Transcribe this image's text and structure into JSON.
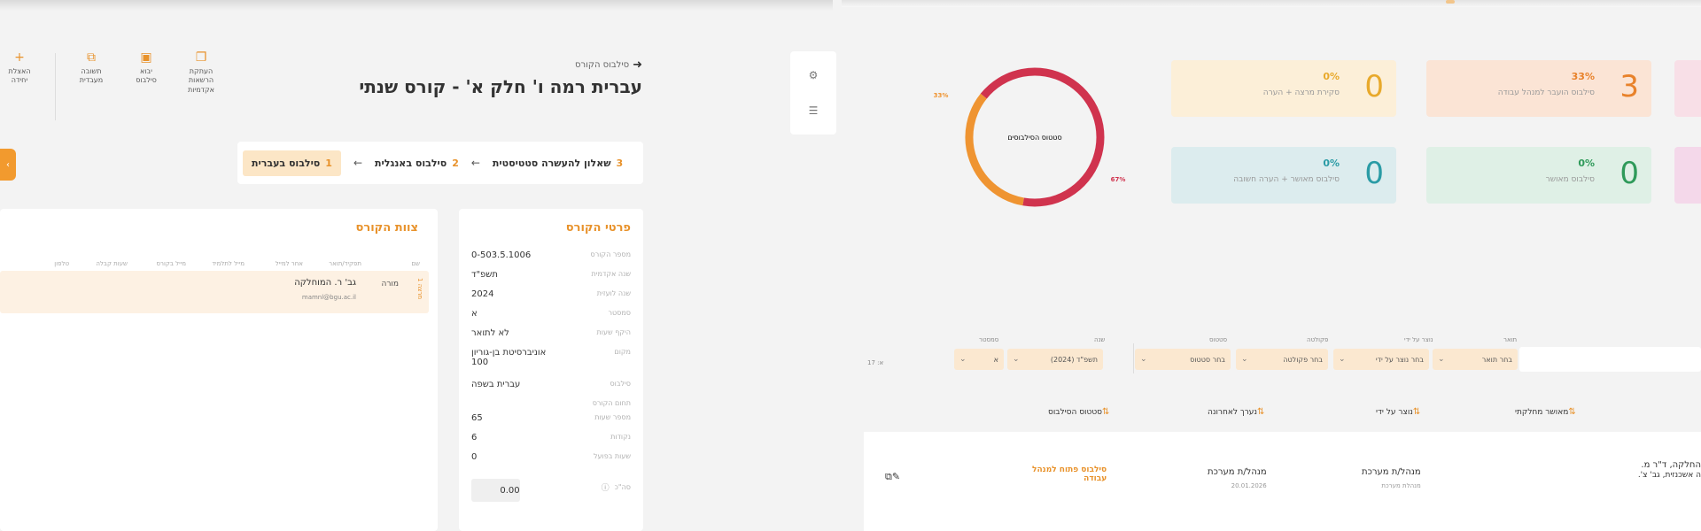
{
  "left": {
    "toolbar": [
      {
        "icon": "plus-icon",
        "glyph": "+",
        "label": "האצלת\nיחידה"
      },
      {
        "icon": "copy-icon",
        "glyph": "⧉",
        "label": "תשובה\nמעבדית"
      },
      {
        "icon": "grid-icon",
        "glyph": "▣",
        "label": "יבוא\nסילבוס"
      },
      {
        "icon": "layers-icon",
        "glyph": "❐",
        "label": "העתקת\nהרשאות\nאקדמיות"
      }
    ],
    "breadcrumb": "סילבוס הקורס",
    "title": "עברית רמה ו' חלק א' - קורס שנתי",
    "steps": [
      {
        "num": "1",
        "label": "סילבוס בעברית",
        "active": true
      },
      {
        "num": "2",
        "label": "סילבוס באנגלית",
        "active": false
      },
      {
        "num": "3",
        "label": "שאלון להעשרה סטטיסטית",
        "active": false
      }
    ],
    "details": {
      "title": "פרטי הקורס",
      "rows": [
        {
          "label": "מספר הקורס",
          "value": "0-503.5.1006"
        },
        {
          "label": "שנה אקדמית",
          "value": "תשפ\"ד"
        },
        {
          "label": "שנה לועזית",
          "value": "2024"
        },
        {
          "label": "סמסטר",
          "value": "א"
        },
        {
          "label": "היקף שעות",
          "value": "לא לתואר"
        },
        {
          "label": "מקום",
          "value": "אוניברסיטת בן-גוריון 100"
        },
        {
          "label": "סילבוס",
          "value": "עברית בשפה"
        },
        {
          "label": "תחום הקורס",
          "value": ""
        },
        {
          "label": "מספר שעות",
          "value": "65"
        },
        {
          "label": "נקודות",
          "value": "6"
        },
        {
          "label": "שעות בפועל",
          "value": "0"
        }
      ],
      "sum_label": "סה\"כ",
      "sum_value": "0.00"
    },
    "team": {
      "title": "צוות הקורס",
      "headers": [
        "שם",
        "תפקיד/תואר",
        "אחר למייל",
        "מייל לתלמיד",
        "מייל בקורס",
        "שעות קבלה",
        "טלפון"
      ],
      "member": {
        "tag": "מרצה 1",
        "role": "מורה",
        "name": "גב' ר. המוחלקה",
        "email": "mamnl@bgu.ac.il"
      }
    }
  },
  "right": {
    "kpis": [
      {
        "value": "3",
        "pct": "33%",
        "label": "סילבוס הועבר למנהל עבודה",
        "style": "peach",
        "color": "#e8822b"
      },
      {
        "value": "0",
        "pct": "0%",
        "label": "סקירת מרצה + הערה",
        "style": "yellow",
        "color": "#e8a92b"
      },
      {
        "value": "0",
        "pct": "0%",
        "label": "סילבוס מאושר",
        "style": "green",
        "color": "#2f9a5a"
      },
      {
        "value": "0",
        "pct": "0%",
        "label": "סילבוס מאושר + הערה חשובה",
        "style": "teal",
        "color": "#2a9ba5"
      }
    ],
    "donut": {
      "label": "סטטוס הסילבוסים",
      "slices": [
        {
          "label": "33%",
          "value": 33,
          "color": "#ef9431"
        },
        {
          "label": "67%",
          "value": 67,
          "color": "#d0334e"
        }
      ]
    },
    "filters": {
      "groups": [
        {
          "label": "תואר",
          "value": "בחר תואר"
        },
        {
          "label": "סטטוס",
          "value": "בחר סטטוס"
        },
        {
          "label": "נוצר על ידי",
          "value": "בחר נוצר על ידי"
        },
        {
          "label": "פקולטה",
          "value": "בחר פקולטה"
        },
        {
          "label": "שנה",
          "value": "תשפ\"ד (2024)"
        },
        {
          "label": "סמסטר",
          "value": "א"
        }
      ],
      "count_label": "א: 17"
    },
    "sort_headers": [
      {
        "label": "מאושר מחלקתי"
      },
      {
        "label": "נוצר על ידי"
      },
      {
        "label": "נערך לאחרונה"
      },
      {
        "label": "סטטוס הסילבוס"
      }
    ],
    "row": {
      "dept_line1": "החלקה, ד\"ר מ.",
      "dept_line2": "ה אשכנזית, גב' צ'.",
      "created_by": "מנהל/ת מערכת",
      "created_by_sub": "מנהלת מערכת",
      "edited_by": "מנהל/ת מערכת",
      "edited_date": "20.01.2026",
      "status": "סילבוס פתוח למנהל",
      "status2": "עבודה"
    }
  }
}
